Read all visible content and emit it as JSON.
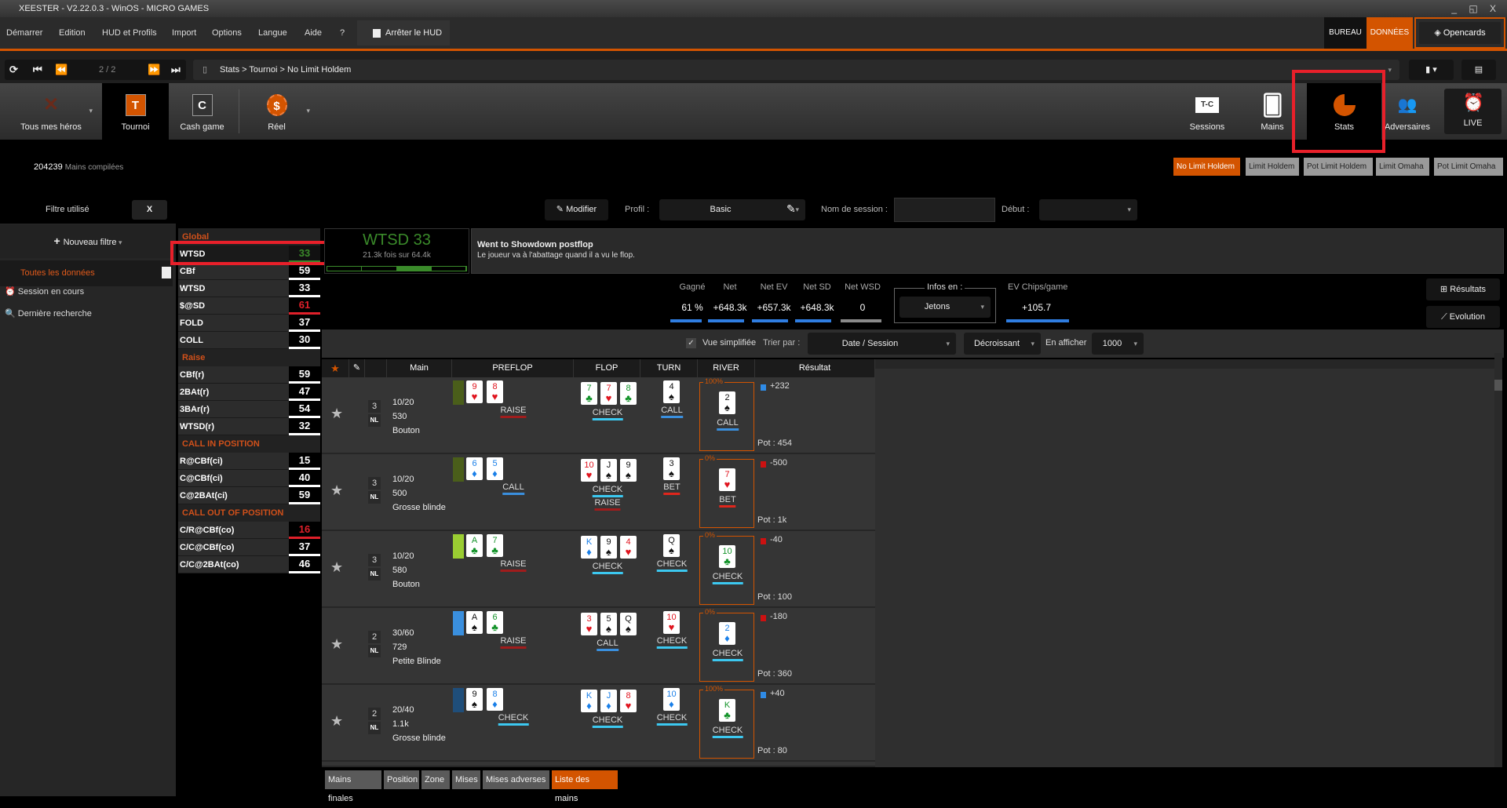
{
  "window": {
    "title": "XEESTER - V2.22.0.3 - WinOS - MICRO GAMES",
    "controls": "_ ◱ X"
  },
  "menu": {
    "items": [
      "Démarrer",
      "Edition",
      "HUD et Profils",
      "Import",
      "Options",
      "Langue",
      "Aide",
      "?"
    ],
    "hud_toggle": "Arrêter le HUD",
    "bureau": "BUREAU",
    "donnees": "DONNÉES",
    "opencards": "Opencards"
  },
  "nav": {
    "page": "2 / 2",
    "breadcrumb": "Stats > Tournoi > No Limit Holdem"
  },
  "toolbar": {
    "left": [
      {
        "label": "Tous mes héros",
        "icon": "Xe"
      },
      {
        "label": "Tournoi",
        "icon": "T"
      },
      {
        "label": "Cash game",
        "icon": "C"
      },
      {
        "label": "Réel",
        "icon": "$"
      }
    ],
    "right": [
      {
        "label": "Sessions",
        "icon": "T-C"
      },
      {
        "label": "Mains"
      },
      {
        "label": "Stats"
      },
      {
        "label": "Adversaires"
      },
      {
        "label": "LIVE"
      }
    ]
  },
  "compiled": {
    "count": "204239",
    "label": "Mains compilées"
  },
  "game_types": [
    {
      "label": "No Limit Holdem",
      "active": true
    },
    {
      "label": "Limit Holdem"
    },
    {
      "label": "Pot Limit Holdem"
    },
    {
      "label": "Limit Omaha"
    },
    {
      "label": "Pot Limit Omaha"
    }
  ],
  "filters": {
    "used": "Filtre utilisé",
    "clear": "X",
    "new": "Nouveau filtre",
    "all": "Toutes les données",
    "session": "Session en cours",
    "last": "Dernière recherche"
  },
  "filterbar": {
    "modify": "Modifier",
    "profile_label": "Profil :",
    "profile": "Basic",
    "session_label": "Nom de session :",
    "session_value": "",
    "start_label": "Début :",
    "start_value": ""
  },
  "stats": [
    {
      "header": "Global"
    },
    {
      "name": "WTSD",
      "value": "33",
      "color": "#3a8a2a",
      "selected": true
    },
    {
      "name": "CBf",
      "value": "59"
    },
    {
      "name": "WTSD",
      "value": "33"
    },
    {
      "name": "$@SD",
      "value": "61",
      "color": "#e0202a"
    },
    {
      "name": "FOLD",
      "value": "37"
    },
    {
      "name": "COLL",
      "value": "30"
    },
    {
      "header": "Raise"
    },
    {
      "name": "CBf(r)",
      "value": "59"
    },
    {
      "name": "2BAt(r)",
      "value": "47"
    },
    {
      "name": "3BAr(r)",
      "value": "54"
    },
    {
      "name": "WTSD(r)",
      "value": "32"
    },
    {
      "header": "CALL IN POSITION"
    },
    {
      "name": "R@CBf(ci)",
      "value": "15"
    },
    {
      "name": "C@CBf(ci)",
      "value": "40"
    },
    {
      "name": "C@2BAt(ci)",
      "value": "59"
    },
    {
      "header": "CALL OUT OF POSITION"
    },
    {
      "name": "C/R@CBf(co)",
      "value": "16",
      "color": "#e0202a"
    },
    {
      "name": "C/C@CBf(co)",
      "value": "37"
    },
    {
      "name": "C/C@2BAt(co)",
      "value": "46"
    }
  ],
  "detail": {
    "title": "WTSD 33",
    "sub": "21.3k fois sur 64.4k",
    "desc_title": "Went to Showdown postflop",
    "desc": "Le joueur va à l'abattage quand il a vu le flop.",
    "bar_segment": 3,
    "bar_segments": 4
  },
  "summary": {
    "cols": [
      {
        "label": "Gagné",
        "value": "61 %"
      },
      {
        "label": "Net",
        "value": "+648.3k"
      },
      {
        "label": "Net EV",
        "value": "+657.3k"
      },
      {
        "label": "Net SD",
        "value": "+648.3k"
      },
      {
        "label": "Net WSD",
        "value": "0"
      }
    ],
    "infos_label": "Infos en :",
    "infos_value": "Jetons",
    "ev_label": "EV Chips/game",
    "ev_value": "+105.7",
    "results_btn": "Résultats",
    "evolution_btn": "Evolution"
  },
  "sortbar": {
    "simplified": "Vue simplifiée",
    "simplified_checked": true,
    "sort_label": "Trier par :",
    "sort_value": "Date / Session",
    "order": "Décroissant",
    "show_label": "En afficher",
    "show_value": "1000"
  },
  "table": {
    "headers": [
      "Main",
      "PREFLOP",
      "FLOP",
      "TURN",
      "RIVER",
      "Résultat"
    ],
    "rows": [
      {
        "players": "3",
        "type": "NL",
        "stakes": "10/20",
        "stack": "530",
        "position": "Bouton",
        "pos_color": "#4a5e1a",
        "pre": [
          "9h",
          "8h"
        ],
        "pre_act": [
          "RAISE"
        ],
        "flop": [
          "7c",
          "7h",
          "8c"
        ],
        "flop_act": [
          "CHECK"
        ],
        "turn": [
          "4s"
        ],
        "turn_act": [
          "CALL"
        ],
        "river_pct": "100%",
        "river": [
          "2s"
        ],
        "river_act": [
          "CALL"
        ],
        "result": "+232",
        "win": true,
        "pot": "Pot : 454"
      },
      {
        "players": "3",
        "type": "NL",
        "stakes": "10/20",
        "stack": "500",
        "position": "Grosse blinde",
        "pos_color": "#4a5e1a",
        "pre": [
          "6d",
          "5d"
        ],
        "pre_act": [
          "CALL"
        ],
        "flop": [
          "10h",
          "Js",
          "9s"
        ],
        "flop_act": [
          "CHECK",
          "RAISE"
        ],
        "turn": [
          "3s"
        ],
        "turn_act": [
          "BET"
        ],
        "river_pct": "0%",
        "river": [
          "7h"
        ],
        "river_act": [
          "BET"
        ],
        "result": "-500",
        "win": false,
        "pot": "Pot : 1k"
      },
      {
        "players": "3",
        "type": "NL",
        "stakes": "10/20",
        "stack": "580",
        "position": "Bouton",
        "pos_color": "#9acd32",
        "pre": [
          "Ac",
          "7c"
        ],
        "pre_act": [
          "RAISE"
        ],
        "flop": [
          "Kd",
          "9s",
          "4h"
        ],
        "flop_act": [
          "CHECK"
        ],
        "turn": [
          "Qs"
        ],
        "turn_act": [
          "CHECK"
        ],
        "river_pct": "0%",
        "river": [
          "10c"
        ],
        "river_act": [
          "CHECK"
        ],
        "result": "-40",
        "win": false,
        "pot": "Pot : 100"
      },
      {
        "players": "2",
        "type": "NL",
        "stakes": "30/60",
        "stack": "729",
        "position": "Petite Blinde",
        "pos_color": "#3a8fde",
        "pre": [
          "As",
          "6c"
        ],
        "pre_act": [
          "RAISE"
        ],
        "flop": [
          "3h",
          "5s",
          "Qs"
        ],
        "flop_act": [
          "CALL"
        ],
        "turn": [
          "10h"
        ],
        "turn_act": [
          "CHECK"
        ],
        "river_pct": "0%",
        "river": [
          "2d"
        ],
        "river_act": [
          "CHECK"
        ],
        "result": "-180",
        "win": false,
        "pot": "Pot : 360"
      },
      {
        "players": "2",
        "type": "NL",
        "stakes": "20/40",
        "stack": "1.1k",
        "position": "Grosse blinde",
        "pos_color": "#1f4e7a",
        "pre": [
          "9s",
          "8d"
        ],
        "pre_act": [
          "CHECK"
        ],
        "flop": [
          "Kd",
          "Jd",
          "8h"
        ],
        "flop_act": [
          "CHECK"
        ],
        "turn": [
          "10d"
        ],
        "turn_act": [
          "CHECK"
        ],
        "river_pct": "100%",
        "river": [
          "Kc"
        ],
        "river_act": [
          "CHECK"
        ],
        "result": "+40",
        "win": true,
        "pot": "Pot : 80"
      }
    ]
  },
  "bottom_tabs": [
    {
      "label": "Mains finales"
    },
    {
      "label": "Position"
    },
    {
      "label": "Zone"
    },
    {
      "label": "Mises"
    },
    {
      "label": "Mises adverses"
    },
    {
      "label": "Liste des mains",
      "active": true
    }
  ],
  "colors": {
    "accent": "#d35400",
    "highlight": "#e8202a",
    "raise": "#a01c1c",
    "check": "#3cc8f0",
    "call": "#3a8fde",
    "bet": "#e0261c",
    "win": "#2f8be6",
    "loss": "#cc1111"
  }
}
